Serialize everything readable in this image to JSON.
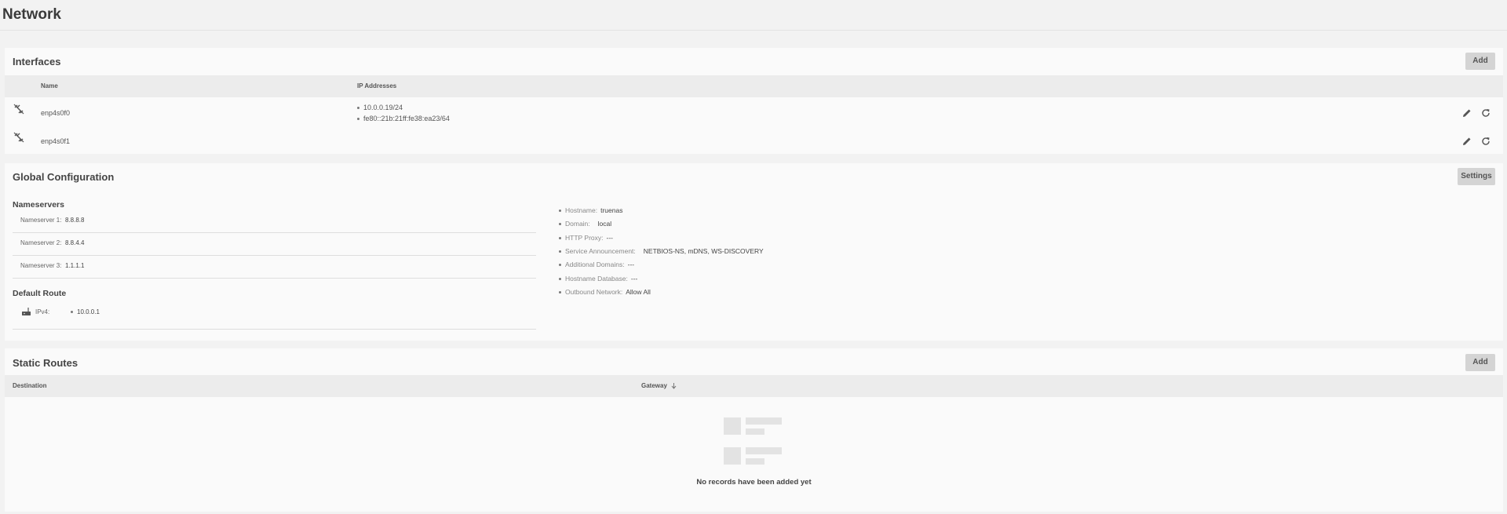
{
  "page": {
    "title": "Network"
  },
  "interfaces": {
    "title": "Interfaces",
    "add_label": "Add",
    "columns": {
      "name": "Name",
      "ip": "IP Addresses"
    },
    "rows": [
      {
        "name": "enp4s0f0",
        "ips": [
          "10.0.0.19/24",
          "fe80::21b:21ff:fe38:ea23/64"
        ]
      },
      {
        "name": "enp4s0f1",
        "ips": []
      }
    ]
  },
  "global": {
    "title": "Global Configuration",
    "settings_label": "Settings",
    "nameservers": {
      "title": "Nameservers",
      "items": [
        {
          "label": "Nameserver 1:",
          "value": "8.8.8.8"
        },
        {
          "label": "Nameserver 2:",
          "value": "8.8.4.4"
        },
        {
          "label": "Nameserver 3:",
          "value": "1.1.1.1"
        }
      ]
    },
    "default_route": {
      "title": "Default Route",
      "label": "IPv4:",
      "value": "10.0.0.1"
    },
    "info": [
      {
        "label": "Hostname:",
        "value": "truenas"
      },
      {
        "label": "Domain:",
        "value": "local"
      },
      {
        "label": "HTTP Proxy:",
        "value": "---"
      },
      {
        "label": "Service Announcement:",
        "value": "NETBIOS-NS, mDNS, WS-DISCOVERY"
      },
      {
        "label": "Additional Domains:",
        "value": "---"
      },
      {
        "label": "Hostname Database:",
        "value": "---"
      },
      {
        "label": "Outbound Network:",
        "value": "Allow All"
      }
    ]
  },
  "static_routes": {
    "title": "Static Routes",
    "add_label": "Add",
    "columns": {
      "destination": "Destination",
      "gateway": "Gateway"
    },
    "empty_text": "No records have been added yet"
  }
}
